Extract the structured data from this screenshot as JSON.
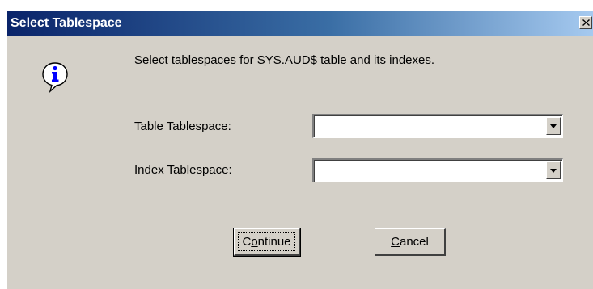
{
  "window": {
    "title": "Select Tablespace",
    "close_icon": "close-icon"
  },
  "message": {
    "icon": "info-icon",
    "text": "Select tablespaces for SYS.AUD$ table and its indexes."
  },
  "fields": {
    "table_tablespace": {
      "label": "Table Tablespace:",
      "value": ""
    },
    "index_tablespace": {
      "label": "Index Tablespace:",
      "value": ""
    }
  },
  "buttons": {
    "continue": {
      "label": "Continue",
      "prefix": "C",
      "mnemonic": "o",
      "suffix": "ntinue"
    },
    "cancel": {
      "label": "Cancel",
      "prefix": "",
      "mnemonic": "C",
      "suffix": "ancel"
    }
  },
  "colors": {
    "dialog_bg": "#d4d0c8",
    "title_bar_start": "#0a246a",
    "title_bar_end": "#a6caf0",
    "info_icon_blue": "#0000ff"
  }
}
